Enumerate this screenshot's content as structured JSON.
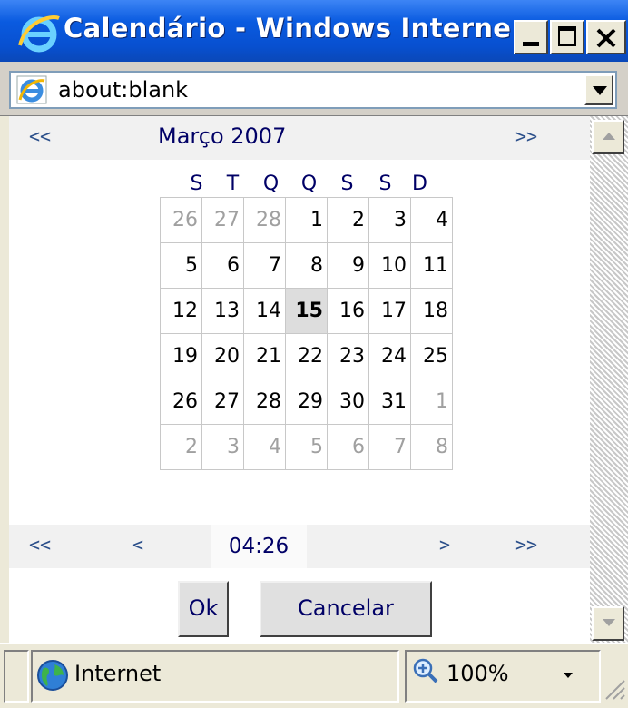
{
  "window": {
    "title": "Calendário - Windows Interne..."
  },
  "address": {
    "url": "about:blank"
  },
  "calendar": {
    "prev_year": "<<",
    "month_year": "Março 2007",
    "next_year": ">>",
    "weekdays": [
      "S",
      "T",
      "Q",
      "Q",
      "S",
      "S",
      "D"
    ],
    "weeks": [
      [
        "26",
        "27",
        "28",
        "1",
        "2",
        "3",
        "4"
      ],
      [
        "5",
        "6",
        "7",
        "8",
        "9",
        "10",
        "11"
      ],
      [
        "12",
        "13",
        "14",
        "15",
        "16",
        "17",
        "18"
      ],
      [
        "19",
        "20",
        "21",
        "22",
        "23",
        "24",
        "25"
      ],
      [
        "26",
        "27",
        "28",
        "29",
        "30",
        "31",
        "1"
      ],
      [
        "2",
        "3",
        "4",
        "5",
        "6",
        "7",
        "8"
      ]
    ],
    "selected_day": "15",
    "time_nav": {
      "prev_prev": "<<",
      "prev": "<",
      "time": "04:26",
      "next": ">",
      "next_next": ">>"
    },
    "ok_label": "Ok",
    "cancel_label": "Cancelar"
  },
  "status": {
    "zone": "Internet",
    "zoom": "100%"
  },
  "colors": {
    "title_blue": "#0a5be0",
    "calendar_text": "#000066",
    "today_bg": "#dddddd"
  }
}
